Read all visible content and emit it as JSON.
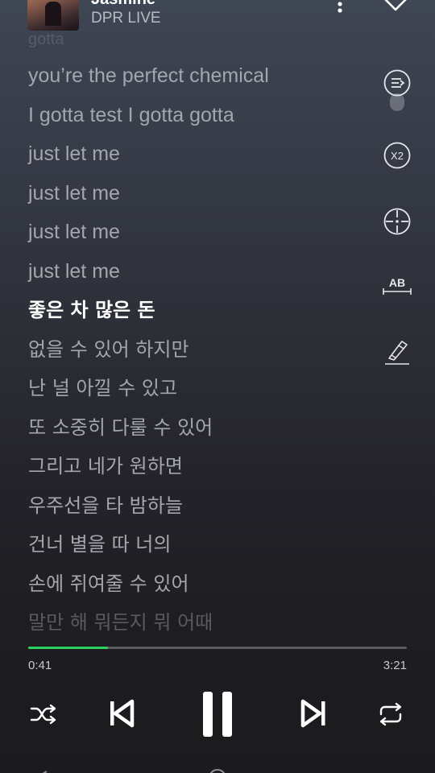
{
  "header": {
    "title": "Jasmine",
    "artist": "DPR LIVE"
  },
  "lyrics": [
    {
      "text": "gotta",
      "state": "faded-top"
    },
    {
      "text": "you’re the perfect chemical",
      "state": "past"
    },
    {
      "text": "I gotta test I gotta gotta",
      "state": "past"
    },
    {
      "text": "just let me",
      "state": "past"
    },
    {
      "text": "just let me",
      "state": "past"
    },
    {
      "text": "just let me",
      "state": "past"
    },
    {
      "text": "just let me",
      "state": "past"
    },
    {
      "text": "좋은 차 많은 돈",
      "state": "active"
    },
    {
      "text": "없을 수 있어 하지만",
      "state": "upcoming"
    },
    {
      "text": "난 널 아낄 수 있고",
      "state": "upcoming"
    },
    {
      "text": "또 소중히 다룰 수 있어",
      "state": "upcoming"
    },
    {
      "text": "그리고 네가 원하면",
      "state": "upcoming"
    },
    {
      "text": "우주선을 타 밤하늘",
      "state": "upcoming"
    },
    {
      "text": "건너 별을 따 너의",
      "state": "upcoming"
    },
    {
      "text": "손에 쥐여줄 수 있어",
      "state": "upcoming"
    },
    {
      "text": "말만 해 뭐든지 뭐 어때",
      "state": "faded-bottom"
    }
  ],
  "side_tools": [
    {
      "name": "queue-icon"
    },
    {
      "name": "speed-x2-icon",
      "label": "X2"
    },
    {
      "name": "target-icon"
    },
    {
      "name": "translate-ab-icon",
      "label": "AB"
    },
    {
      "name": "highlight-pen-icon"
    }
  ],
  "playback": {
    "elapsed": "0:41",
    "total": "3:21",
    "progress_fraction": 0.21,
    "accent_color": "#2bd25e"
  },
  "controls": [
    {
      "name": "shuffle-icon"
    },
    {
      "name": "previous-icon"
    },
    {
      "name": "pause-icon"
    },
    {
      "name": "next-icon"
    },
    {
      "name": "repeat-icon"
    }
  ]
}
